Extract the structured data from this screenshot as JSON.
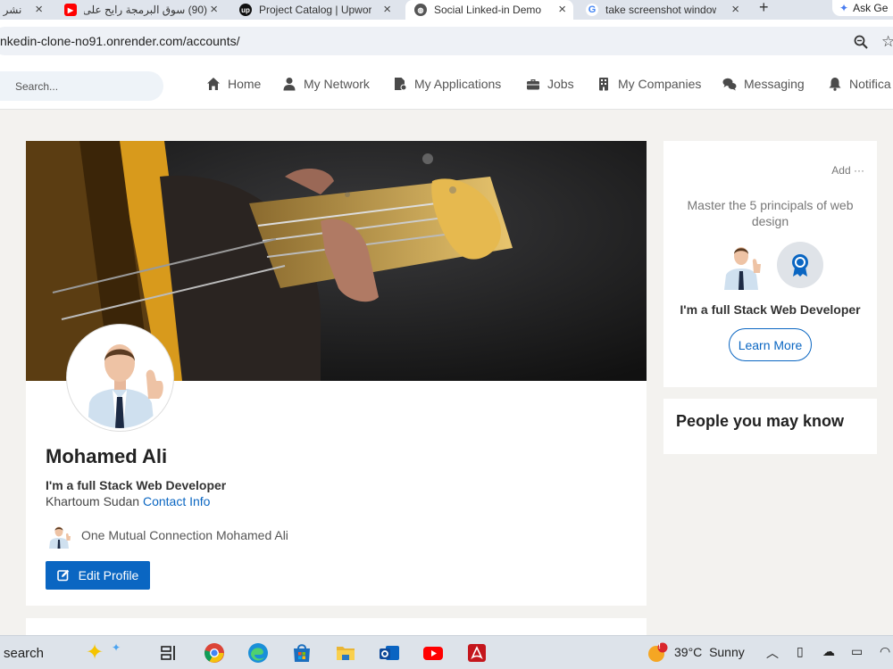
{
  "browser": {
    "tabs": [
      {
        "title": "نشر ه",
        "icon": "page-icon",
        "active": false
      },
      {
        "title": "(90) سوق البرمجة رايح على",
        "icon": "youtube-icon",
        "active": false
      },
      {
        "title": "Project Catalog | Upwork",
        "icon": "upwork-icon",
        "active": false
      },
      {
        "title": "Social Linked-in Demo",
        "icon": "globe-icon",
        "active": true
      },
      {
        "title": "take screenshot window",
        "icon": "google-icon",
        "active": false
      }
    ],
    "ask_label": "Ask Ge",
    "url": "nkedin-clone-no91.onrender.com/accounts/"
  },
  "nav": {
    "search_placeholder": "Search...",
    "items": [
      {
        "label": "Home",
        "icon": "home-icon"
      },
      {
        "label": "My Network",
        "icon": "user-icon"
      },
      {
        "label": "My Applications",
        "icon": "file-icon"
      },
      {
        "label": "Jobs",
        "icon": "briefcase-icon"
      },
      {
        "label": "My Companies",
        "icon": "building-icon"
      },
      {
        "label": "Messaging",
        "icon": "chat-icon"
      },
      {
        "label": "Notifica",
        "icon": "bell-icon"
      }
    ]
  },
  "profile": {
    "name": "Mohamed Ali",
    "headline": "I'm a full Stack Web Developer",
    "location": "Khartoum Sudan",
    "contact_link": "Contact Info",
    "mutual": "One Mutual Connection Mohamed Ali",
    "edit_label": "Edit Profile"
  },
  "ad": {
    "label": "Add",
    "text": "Master the 5 principals of web design",
    "title": "I'm a full Stack Web Developer",
    "button": "Learn More"
  },
  "people": {
    "title": "People you may know"
  },
  "taskbar": {
    "search": "search",
    "weather_badge": "!",
    "temperature": "39°C",
    "condition": "Sunny"
  },
  "colors": {
    "accent": "#0a66c2",
    "background": "#f3f2ef"
  }
}
